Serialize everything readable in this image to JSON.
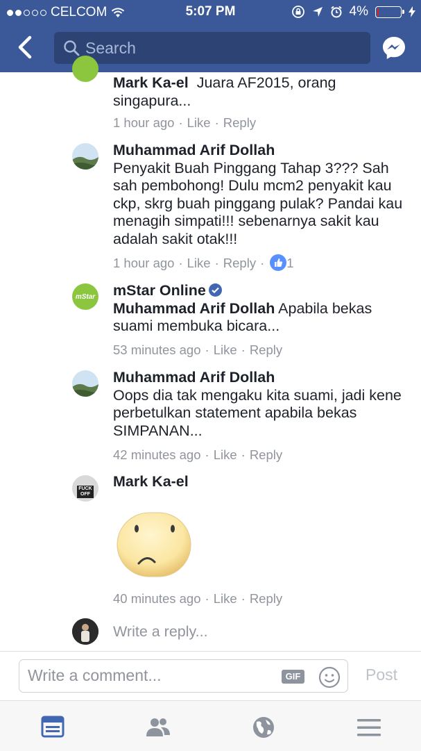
{
  "status_bar": {
    "carrier": "CELCOM",
    "time": "5:07 PM",
    "battery_percent_label": "4%",
    "battery_level": 0.04,
    "signal_bars_filled": 2
  },
  "header": {
    "search_placeholder": "Search",
    "colors": {
      "background": "#3b5998",
      "search_bg": "#2d4373"
    }
  },
  "comments": [
    {
      "author": "Mark Ka-el",
      "text": "Juara AF2015, orang singapura...",
      "time": "1 hour ago",
      "like_label": "Like",
      "reply_label": "Reply"
    },
    {
      "author": "Muhammad Arif Dollah",
      "text": "Penyakit Buah Pinggang Tahap 3??? Sah sah pembohong! Dulu mcm2 penyakit kau ckp, skrg buah pinggang pulak? Pandai kau menagih simpati!!! sebenarnya sakit kau adalah sakit otak!!!",
      "time": "1 hour ago",
      "like_label": "Like",
      "reply_label": "Reply",
      "like_count": "1"
    },
    {
      "author": "mStar Online",
      "verified": true,
      "mention": "Muhammad Arif Dollah",
      "text": "Apabila bekas suami membuka bicara...",
      "time": "53 minutes ago",
      "like_label": "Like",
      "reply_label": "Reply",
      "avatar_text": "mStar"
    },
    {
      "author": "Muhammad Arif Dollah",
      "text": "Oops dia tak mengaku kita suami, jadi kene perbetulkan statement apabila bekas SIMPANAN...",
      "time": "42 minutes ago",
      "like_label": "Like",
      "reply_label": "Reply"
    },
    {
      "author": "Mark Ka-el",
      "sticker": "sad-face-sticker",
      "time": "40 minutes ago",
      "like_label": "Like",
      "reply_label": "Reply",
      "avatar_text": "FUCK OFF"
    }
  ],
  "reply_box": {
    "placeholder": "Write a reply..."
  },
  "composer": {
    "placeholder": "Write a comment...",
    "gif_label": "GIF",
    "post_label": "Post"
  },
  "tabbar": {
    "tabs": [
      "news-feed-icon",
      "friends-icon",
      "globe-icon",
      "menu-icon"
    ],
    "active_color": "#4267b2",
    "inactive_color": "#8d949e"
  }
}
